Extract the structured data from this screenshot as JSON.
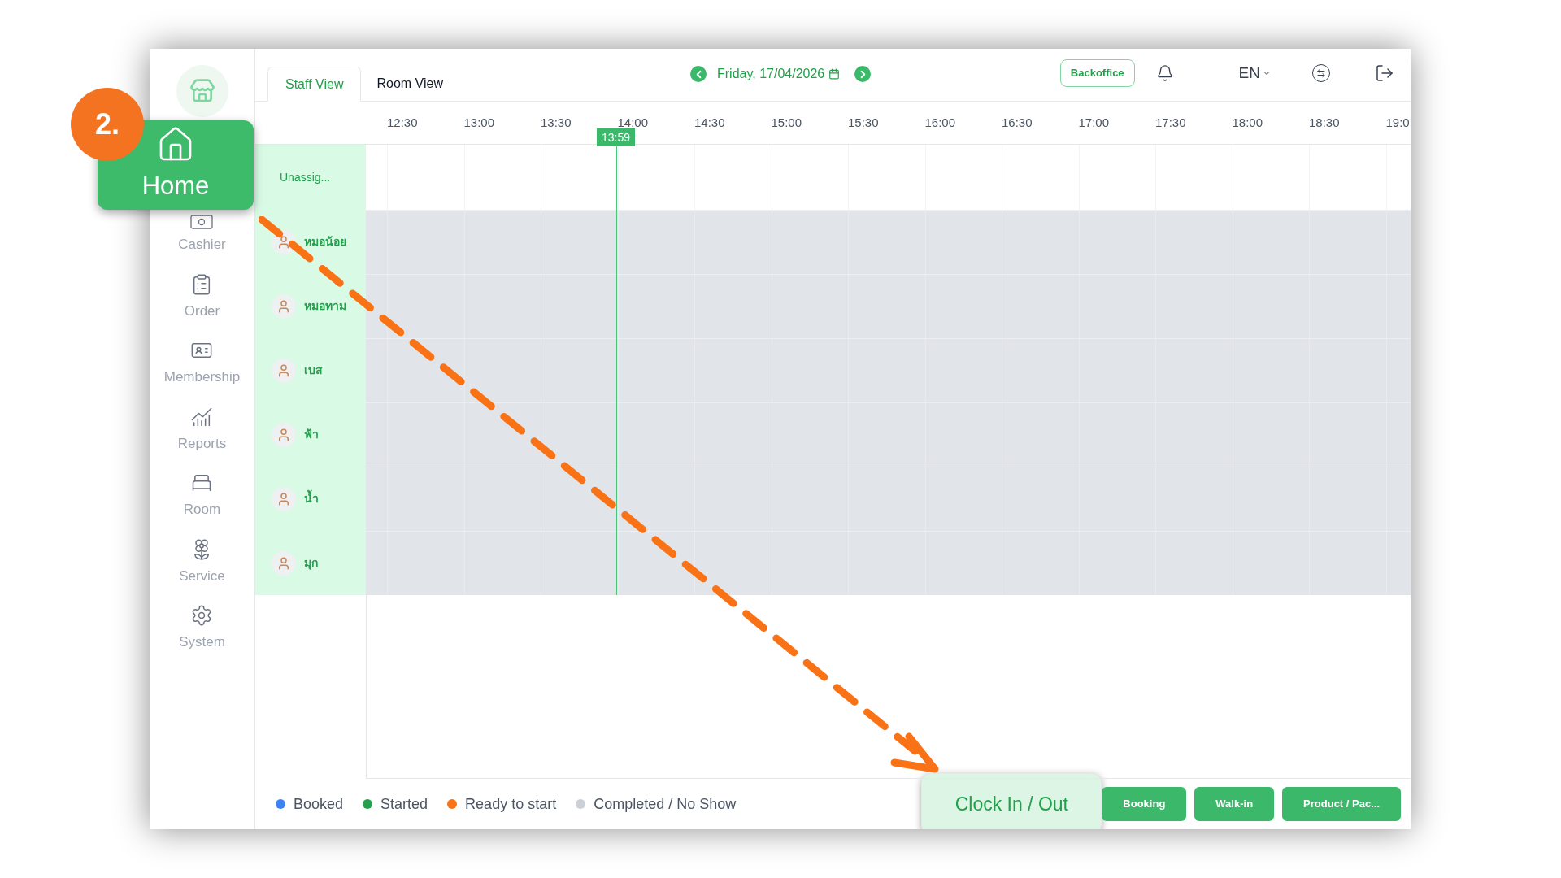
{
  "callout": {
    "step": "2.",
    "label": "Home"
  },
  "sidebar": {
    "items": [
      {
        "label": "Cashier"
      },
      {
        "label": "Order"
      },
      {
        "label": "Membership"
      },
      {
        "label": "Reports"
      },
      {
        "label": "Room"
      },
      {
        "label": "Service"
      },
      {
        "label": "System"
      }
    ]
  },
  "tabs": [
    {
      "label": "Staff View",
      "selected": true
    },
    {
      "label": "Room View",
      "selected": false
    }
  ],
  "date": "Friday, 17/04/2026",
  "header": {
    "backoffice": "Backoffice",
    "language": "EN"
  },
  "timeline": {
    "times": [
      "12:30",
      "13:00",
      "13:30",
      "14:00",
      "14:30",
      "15:00",
      "15:30",
      "16:00",
      "16:30",
      "17:00",
      "17:30",
      "18:00",
      "18:30",
      "19:0"
    ],
    "current_time": "13:59",
    "unassigned": "Unassig...",
    "staff": [
      {
        "name": "หมอน้อย"
      },
      {
        "name": "หมอทาม"
      },
      {
        "name": "เบส"
      },
      {
        "name": "ฟ้า"
      },
      {
        "name": "น้ำ"
      },
      {
        "name": "มุก"
      }
    ]
  },
  "legend": [
    {
      "label": "Booked",
      "color": "#3b82f6"
    },
    {
      "label": "Started",
      "color": "#22a04b"
    },
    {
      "label": "Ready to start",
      "color": "#f97316"
    },
    {
      "label": "Completed / No Show",
      "color": "#cbd0d6"
    }
  ],
  "buttons": [
    {
      "label": "Clock In / Out",
      "highlighted": true
    },
    {
      "label": "Booking",
      "highlighted": false
    },
    {
      "label": "Walk-in",
      "highlighted": false
    },
    {
      "label": "Product / Pac...",
      "highlighted": false
    }
  ]
}
